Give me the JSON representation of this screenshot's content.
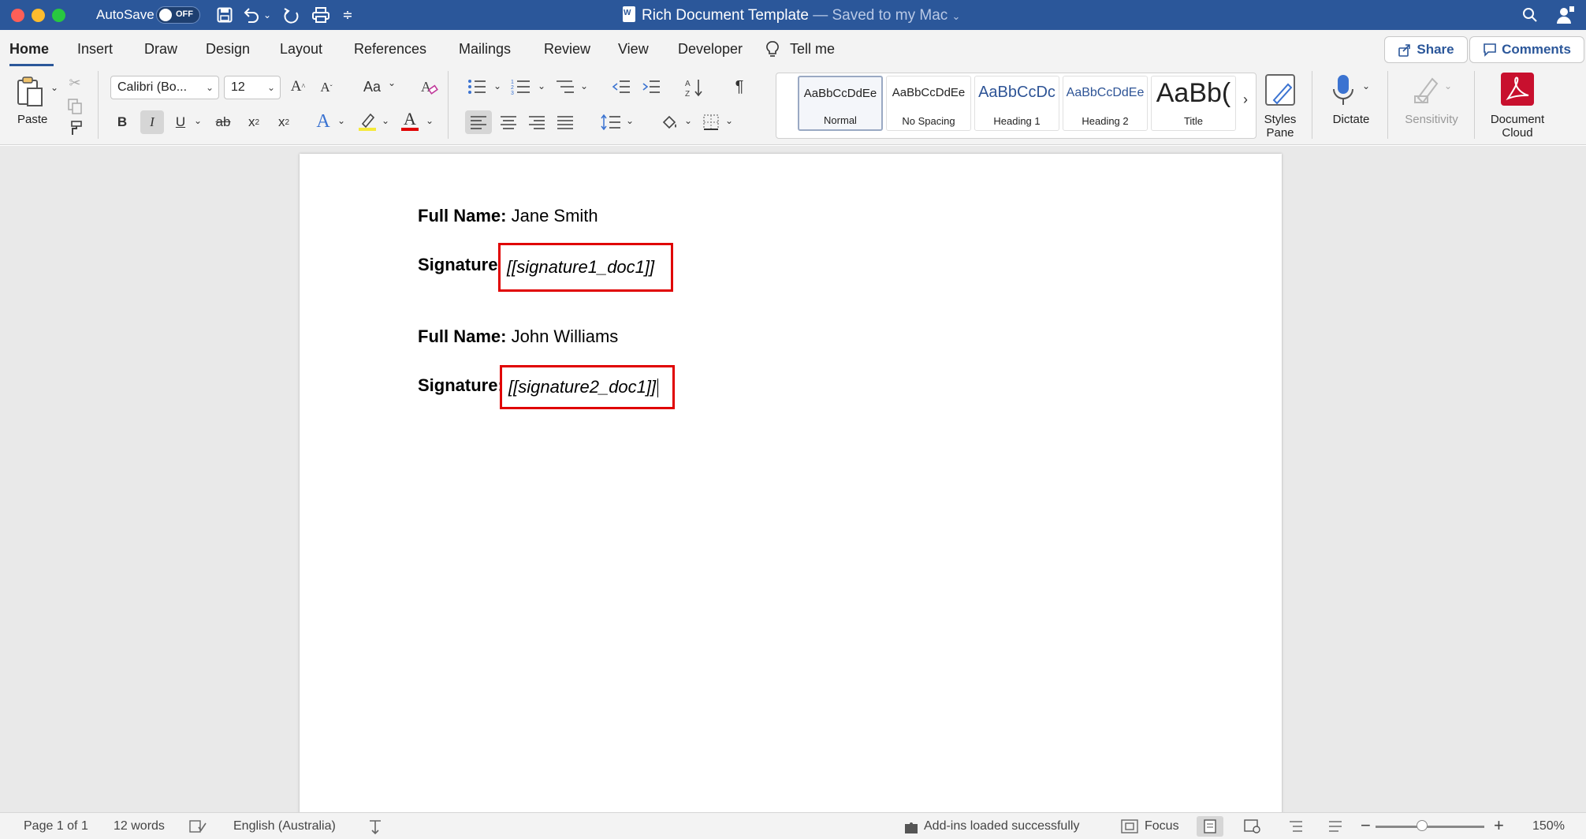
{
  "titlebar": {
    "autosave_label": "AutoSave",
    "autosave_state": "OFF",
    "document_name": "Rich Document Template",
    "save_status": "— Saved to my Mac"
  },
  "tabs": [
    {
      "label": "Home",
      "active": true
    },
    {
      "label": "Insert"
    },
    {
      "label": "Draw"
    },
    {
      "label": "Design"
    },
    {
      "label": "Layout"
    },
    {
      "label": "References"
    },
    {
      "label": "Mailings"
    },
    {
      "label": "Review"
    },
    {
      "label": "View"
    },
    {
      "label": "Developer"
    },
    {
      "label": "Tell me"
    }
  ],
  "actions": {
    "share_label": "Share",
    "comments_label": "Comments"
  },
  "ribbon": {
    "paste_label": "Paste",
    "font_name": "Calibri (Bo...",
    "font_size": "12",
    "change_case_label": "Aa",
    "styles": [
      {
        "sample": "AaBbCcDdEe",
        "name": "Normal",
        "selected": true
      },
      {
        "sample": "AaBbCcDdEe",
        "name": "No Spacing"
      },
      {
        "sample": "AaBbCcDc",
        "name": "Heading 1"
      },
      {
        "sample": "AaBbCcDdEe",
        "name": "Heading 2"
      },
      {
        "sample": "AaBb(",
        "name": "Title"
      }
    ],
    "styles_pane_label_1": "Styles",
    "styles_pane_label_2": "Pane",
    "dictate_label": "Dictate",
    "sensitivity_label": "Sensitivity",
    "document_cloud_label_1": "Document",
    "document_cloud_label_2": "Cloud",
    "colors": {
      "highlight": "#f5e93a",
      "font_color": "#e00000",
      "accent": "#2b579a"
    }
  },
  "document": {
    "entries": [
      {
        "name_label": "Full Name:",
        "name_value": "Jane Smith",
        "signature_label": "Signature",
        "signature_placeholder": "[[signature1_doc1]]"
      },
      {
        "name_label": "Full Name:",
        "name_value": "John Williams",
        "signature_label": "Signature:",
        "signature_placeholder": "[[signature2_doc1]]"
      }
    ]
  },
  "statusbar": {
    "page": "Page 1 of 1",
    "words": "12 words",
    "language": "English (Australia)",
    "addins": "Add-ins loaded successfully",
    "focus": "Focus",
    "zoom": "150%",
    "zoom_level_fraction": 0.43
  }
}
